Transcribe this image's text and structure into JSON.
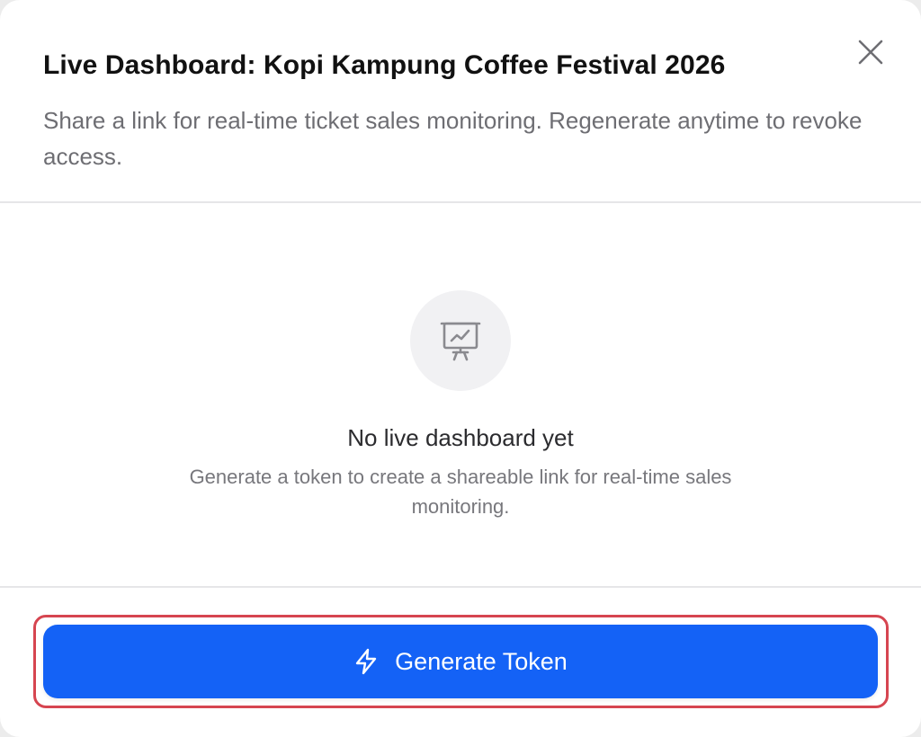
{
  "dialog": {
    "title": "Live Dashboard: Kopi Kampung Coffee Festival 2026",
    "subtitle": "Share a link for real-time ticket sales monitoring. Regenerate anytime to revoke access.",
    "close_icon": "close-icon"
  },
  "empty_state": {
    "icon": "presentation-chart-icon",
    "title": "No live dashboard yet",
    "description": "Generate a token to create a shareable link for real-time sales monitoring."
  },
  "footer": {
    "generate_button_label": "Generate Token",
    "generate_button_icon": "lightning-icon"
  },
  "colors": {
    "primary": "#1462f6",
    "highlight": "#d64550",
    "muted_text": "#6e6e73",
    "icon_bg": "#f1f1f3"
  }
}
